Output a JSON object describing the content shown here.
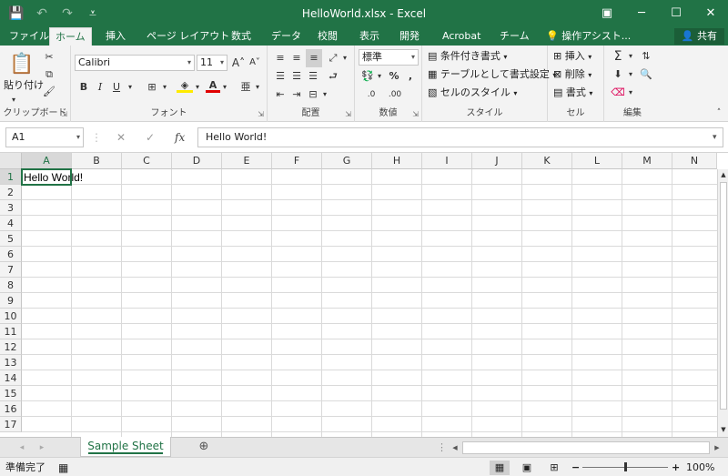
{
  "app": {
    "title": "HelloWorld.xlsx - Excel",
    "share_label": "共有",
    "tell_me": "操作アシスト..."
  },
  "tabs": [
    "ファイル",
    "ホーム",
    "挿入",
    "ページ レイアウト",
    "数式",
    "データ",
    "校閲",
    "表示",
    "開発",
    "Acrobat",
    "チーム"
  ],
  "ribbon": {
    "clipboard": {
      "label": "クリップボード",
      "paste": "貼り付け"
    },
    "font": {
      "label": "フォント",
      "name": "Calibri",
      "size": "11"
    },
    "alignment": {
      "label": "配置"
    },
    "number": {
      "label": "数値",
      "format": "標準"
    },
    "styles": {
      "label": "スタイル",
      "conditional": "条件付き書式",
      "as_table": "テーブルとして書式設定",
      "cell_styles": "セルのスタイル"
    },
    "cells": {
      "label": "セル",
      "insert": "挿入",
      "delete": "削除",
      "format": "書式"
    },
    "editing": {
      "label": "編集"
    }
  },
  "formula_bar": {
    "name_box": "A1",
    "fx": "fx",
    "content": "Hello World!"
  },
  "grid": {
    "columns": [
      "A",
      "B",
      "C",
      "D",
      "E",
      "F",
      "G",
      "H",
      "I",
      "J",
      "K",
      "L",
      "M",
      "N"
    ],
    "rows": [
      "1",
      "2",
      "3",
      "4",
      "5",
      "6",
      "7",
      "8",
      "9",
      "10",
      "11",
      "12",
      "13",
      "14",
      "15",
      "16",
      "17"
    ],
    "cell_a1": "Hello World!"
  },
  "sheets": {
    "active": "Sample Sheet"
  },
  "status": {
    "ready": "準備完了",
    "zoom": "100%"
  },
  "colors": {
    "brand": "#217346"
  }
}
